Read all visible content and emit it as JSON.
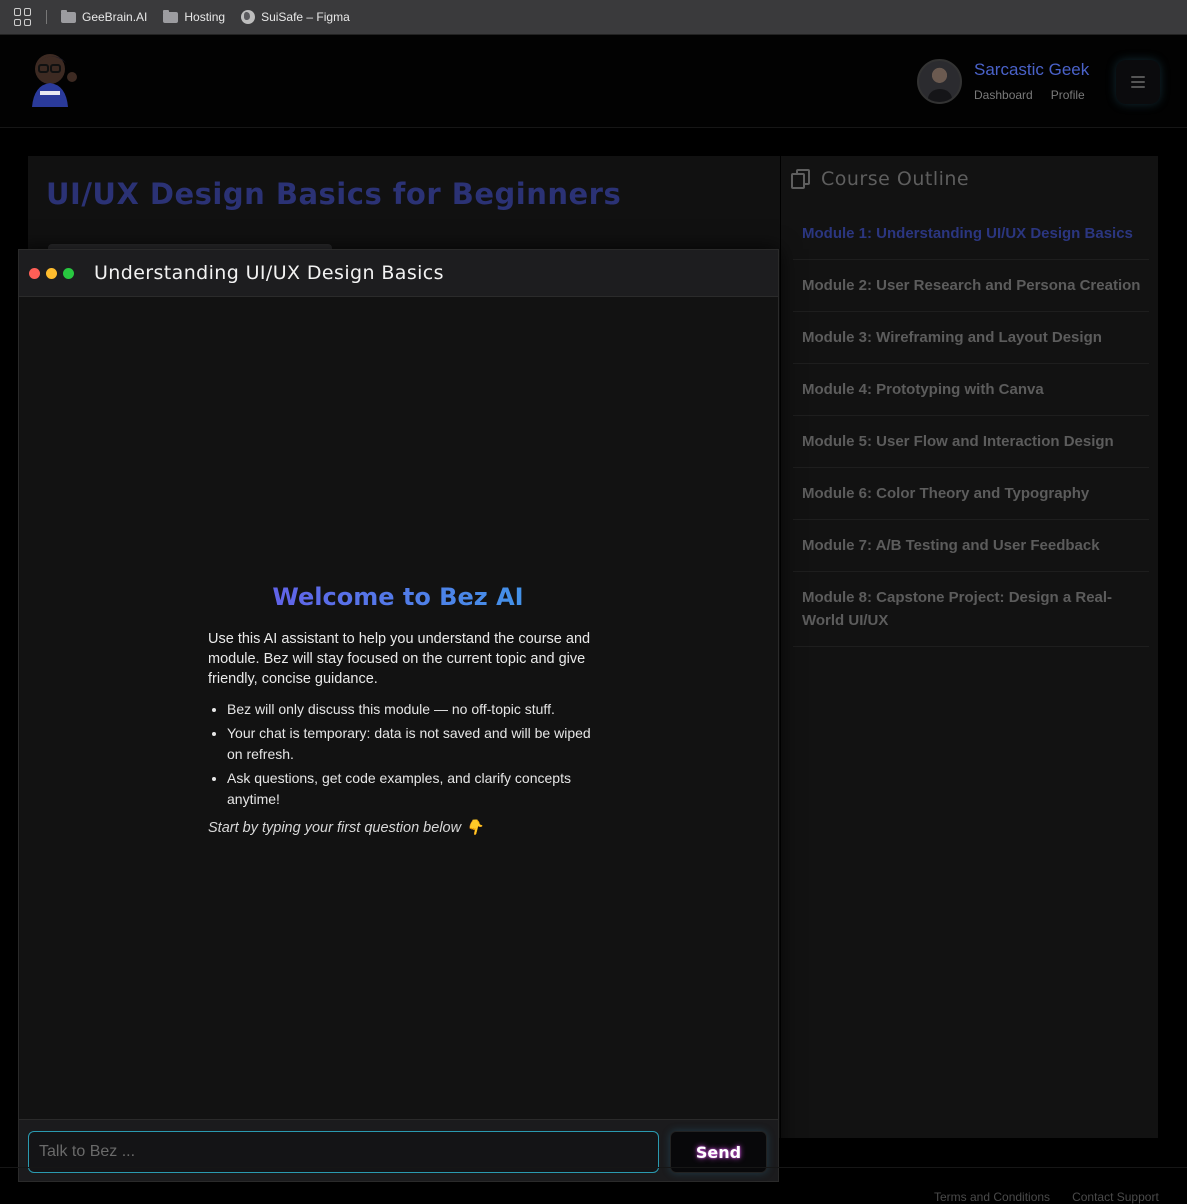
{
  "bookmarks": {
    "items": [
      {
        "label": "GeeBrain.AI",
        "icon": "folder-icon"
      },
      {
        "label": "Hosting",
        "icon": "folder-icon"
      },
      {
        "label": "SuiSafe – Figma",
        "icon": "globe-icon"
      }
    ]
  },
  "header": {
    "username": "Sarcastic Geek",
    "nav": {
      "dashboard": "Dashboard",
      "profile": "Profile"
    }
  },
  "course": {
    "title": "UI/UX Design Basics for Beginners"
  },
  "outline": {
    "title": "Course Outline",
    "modules": [
      "Module 1: Understanding UI/UX Design Basics",
      "Module 2: User Research and Persona Creation",
      "Module 3: Wireframing and Layout Design",
      "Module 4: Prototyping with Canva",
      "Module 5: User Flow and Interaction Design",
      "Module 6: Color Theory and Typography",
      "Module 7: A/B Testing and User Feedback",
      "Module 8: Capstone Project: Design a Real-World UI/UX"
    ],
    "active_index": 0
  },
  "chat": {
    "title": "Understanding UI/UX Design Basics",
    "welcome_title": "Welcome to Bez AI",
    "intro": "Use this AI assistant to help you understand the course and module. Bez will stay focused on the current topic and give friendly, concise guidance.",
    "bullets": [
      "Bez will only discuss this module — no off-topic stuff.",
      "Your chat is temporary: data is not saved and will be wiped on refresh.",
      "Ask questions, get code examples, and clarify concepts anytime!"
    ],
    "hint": "Start by typing your first question below 👇",
    "input_placeholder": "Talk to Bez ...",
    "send_label": "Send"
  },
  "footer": {
    "terms": "Terms and Conditions",
    "support": "Contact Support"
  },
  "colors": {
    "accent_blue": "#4a62c9",
    "active_module": "#2b3680",
    "input_border": "#2a9ab0",
    "send_glow": "#c04ad0",
    "dot_red": "#ff5f57",
    "dot_yellow": "#febc2e",
    "dot_green": "#28c840"
  }
}
